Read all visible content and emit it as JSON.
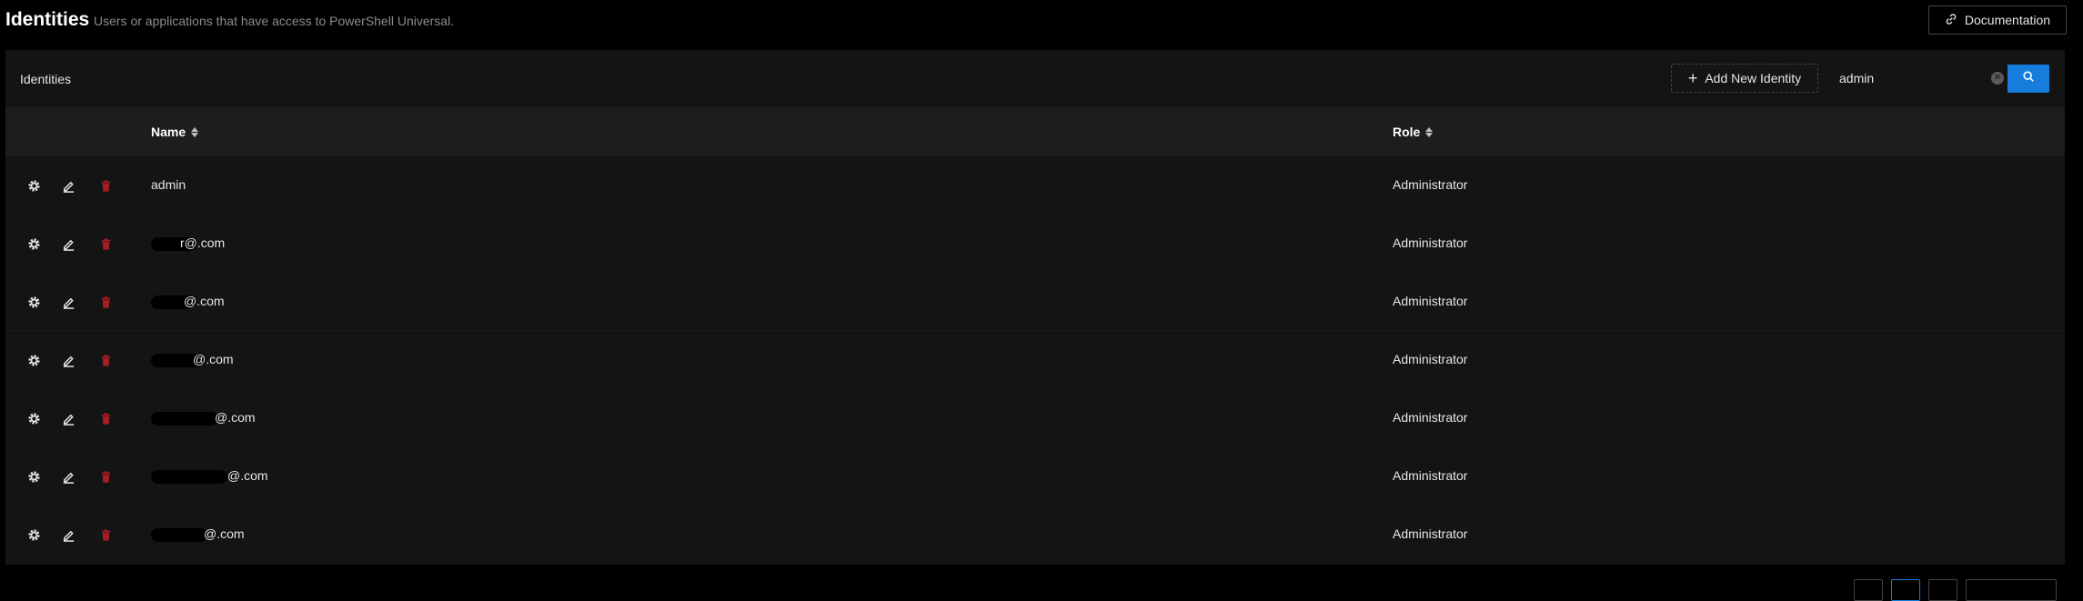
{
  "header": {
    "title": "Identities",
    "subtitle": "Users or applications that have access to PowerShell Universal.",
    "doc_button": "Documentation"
  },
  "card": {
    "title": "Identities",
    "add_button": "Add New Identity",
    "search": {
      "value": "admin",
      "placeholder": ""
    }
  },
  "table": {
    "columns": {
      "name": "Name",
      "role": "Role"
    },
    "rows": [
      {
        "name": "admin",
        "role": "Administrator"
      },
      {
        "name": "r@.com",
        "role": "Administrator"
      },
      {
        "name": "@.com",
        "role": "Administrator"
      },
      {
        "name": "@.com",
        "role": "Administrator"
      },
      {
        "name": "@.com",
        "role": "Administrator"
      },
      {
        "name": "@.com",
        "role": "Administrator"
      },
      {
        "name": "@.com",
        "role": "Administrator"
      }
    ]
  },
  "icons": {
    "row_actions": [
      "gear-icon",
      "edit-icon",
      "delete-icon"
    ],
    "search": "search-icon",
    "documentation": "link-icon"
  },
  "colors": {
    "primary": "#177ddc",
    "danger": "#a61d24",
    "background": "#000000",
    "card": "#141414",
    "table_header": "#1d1d1d"
  }
}
